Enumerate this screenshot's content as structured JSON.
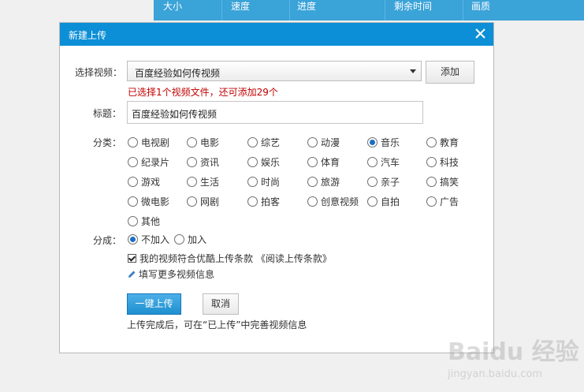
{
  "background_header": {
    "columns": [
      "大小",
      "速度",
      "进度",
      "剩余时间",
      "画质"
    ]
  },
  "dialog": {
    "title": "新建上传",
    "select_video_label": "选择视频：",
    "selected_video": "百度经验如何传视频",
    "add_button": "添加",
    "selection_hint": "已选择1个视频文件，还可添加29个",
    "title_label": "标题：",
    "title_value": "百度经验如何传视频",
    "category_label": "分类：",
    "categories": [
      {
        "label": "电视剧",
        "checked": false
      },
      {
        "label": "电影",
        "checked": false
      },
      {
        "label": "综艺",
        "checked": false
      },
      {
        "label": "动漫",
        "checked": false
      },
      {
        "label": "音乐",
        "checked": true
      },
      {
        "label": "教育",
        "checked": false
      },
      {
        "label": "纪录片",
        "checked": false
      },
      {
        "label": "资讯",
        "checked": false
      },
      {
        "label": "娱乐",
        "checked": false
      },
      {
        "label": "体育",
        "checked": false
      },
      {
        "label": "汽车",
        "checked": false
      },
      {
        "label": "科技",
        "checked": false
      },
      {
        "label": "游戏",
        "checked": false
      },
      {
        "label": "生活",
        "checked": false
      },
      {
        "label": "时尚",
        "checked": false
      },
      {
        "label": "旅游",
        "checked": false
      },
      {
        "label": "亲子",
        "checked": false
      },
      {
        "label": "搞笑",
        "checked": false
      },
      {
        "label": "微电影",
        "checked": false
      },
      {
        "label": "网剧",
        "checked": false
      },
      {
        "label": "拍客",
        "checked": false
      },
      {
        "label": "创意视频",
        "checked": false
      },
      {
        "label": "自拍",
        "checked": false
      },
      {
        "label": "广告",
        "checked": false
      },
      {
        "label": "其他",
        "checked": false
      }
    ],
    "share_label": "分成：",
    "share_options": [
      {
        "label": "不加入",
        "checked": true
      },
      {
        "label": "加入",
        "checked": false
      }
    ],
    "terms_checkbox_label": "我的视频符合优酷上传条款 《阅读上传条款》",
    "terms_checked": true,
    "more_info_link": "填写更多视频信息",
    "upload_button": "一键上传",
    "cancel_button": "取消",
    "footer_note": "上传完成后，可在“已上传”中完善视频信息"
  },
  "watermark": {
    "brand": "Baidu 经验",
    "url": "jingyan.baidu.com"
  },
  "icons": {
    "close": "close-icon",
    "pencil": "pencil-icon",
    "dropdown": "chevron-down-icon"
  },
  "colors": {
    "titlebar": "#0c8fd6",
    "header": "#3aa3d8",
    "hint": "#c00000",
    "primary_button": "#1e8fd0"
  }
}
